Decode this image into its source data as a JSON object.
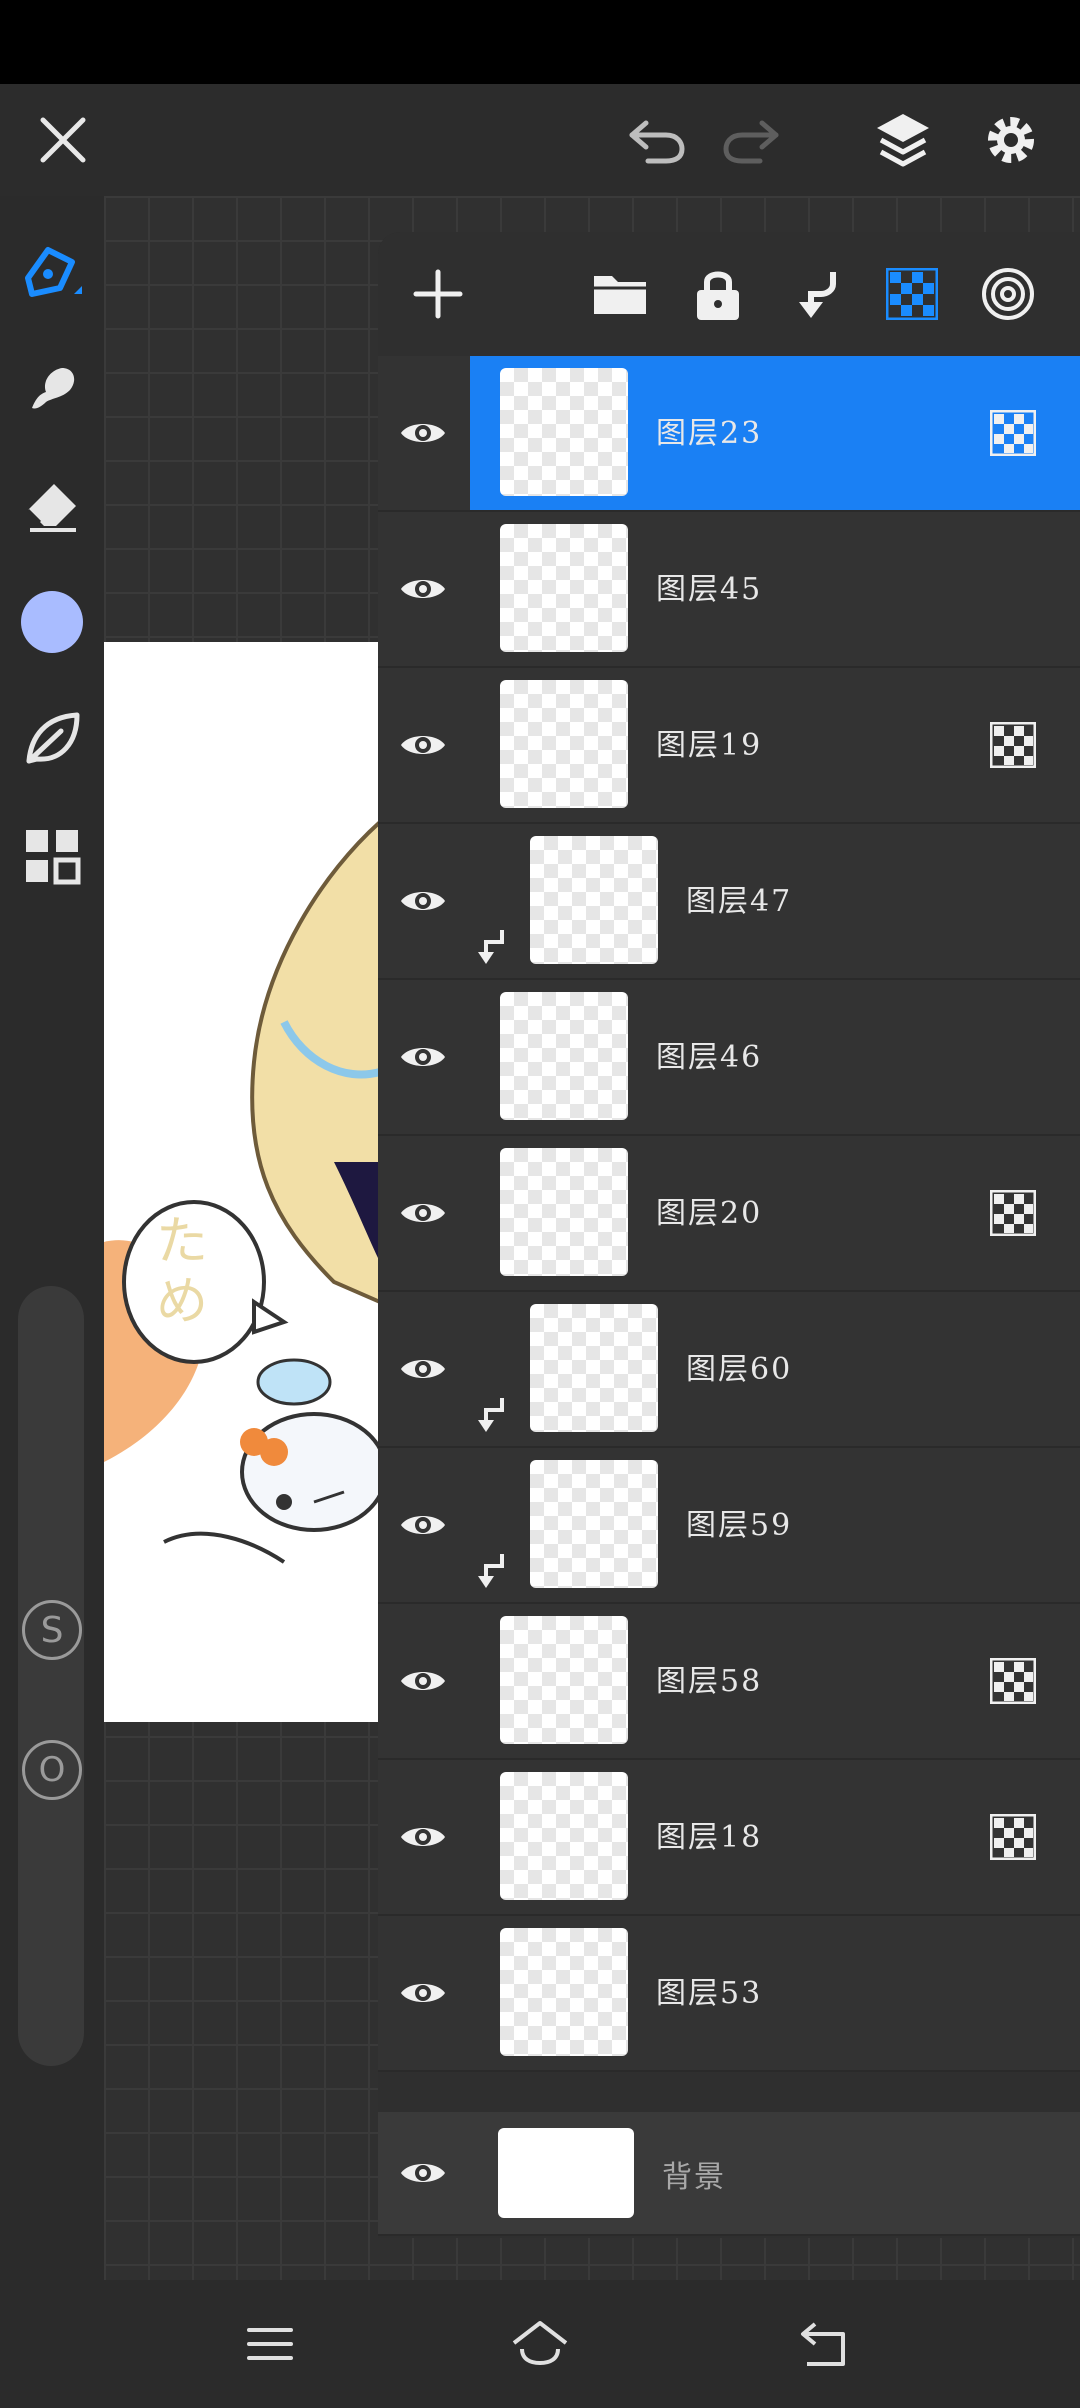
{
  "colors": {
    "accent": "#1a80f4",
    "brush_color": "#a9bcff",
    "panel": "#2f2f2f",
    "toolbar": "#2c2c2c"
  },
  "topbar": {
    "icons": [
      "close-icon",
      "undo-icon",
      "redo-icon",
      "layers-icon",
      "settings-icon"
    ]
  },
  "tools": [
    "pen-icon",
    "smudge-icon",
    "eraser-icon",
    "color-swatch",
    "leaf-icon",
    "grid-icon"
  ],
  "side_sliders": {
    "size_label": "S",
    "opacity_label": "O"
  },
  "artboard": {
    "speech_text": "ため"
  },
  "layers_toolbar": {
    "icons": [
      "add-icon",
      "folder-icon",
      "lock-icon",
      "clip-icon",
      "checker-icon",
      "target-icon"
    ]
  },
  "layers": [
    {
      "name": "图层23",
      "selected": true,
      "clipped": false,
      "blend_icon": true
    },
    {
      "name": "图层45",
      "selected": false,
      "clipped": false,
      "blend_icon": false
    },
    {
      "name": "图层19",
      "selected": false,
      "clipped": false,
      "blend_icon": true
    },
    {
      "name": "图层47",
      "selected": false,
      "clipped": true,
      "blend_icon": false
    },
    {
      "name": "图层46",
      "selected": false,
      "clipped": false,
      "blend_icon": false
    },
    {
      "name": "图层20",
      "selected": false,
      "clipped": false,
      "blend_icon": true
    },
    {
      "name": "图层60",
      "selected": false,
      "clipped": true,
      "blend_icon": false
    },
    {
      "name": "图层59",
      "selected": false,
      "clipped": true,
      "blend_icon": false
    },
    {
      "name": "图层58",
      "selected": false,
      "clipped": false,
      "blend_icon": true
    },
    {
      "name": "图层18",
      "selected": false,
      "clipped": false,
      "blend_icon": true
    },
    {
      "name": "图层53",
      "selected": false,
      "clipped": false,
      "blend_icon": false
    }
  ],
  "background_layer": {
    "name": "背景"
  },
  "bottom_nav": {
    "icons": [
      "menu-icon",
      "home-icon",
      "back-icon"
    ]
  }
}
